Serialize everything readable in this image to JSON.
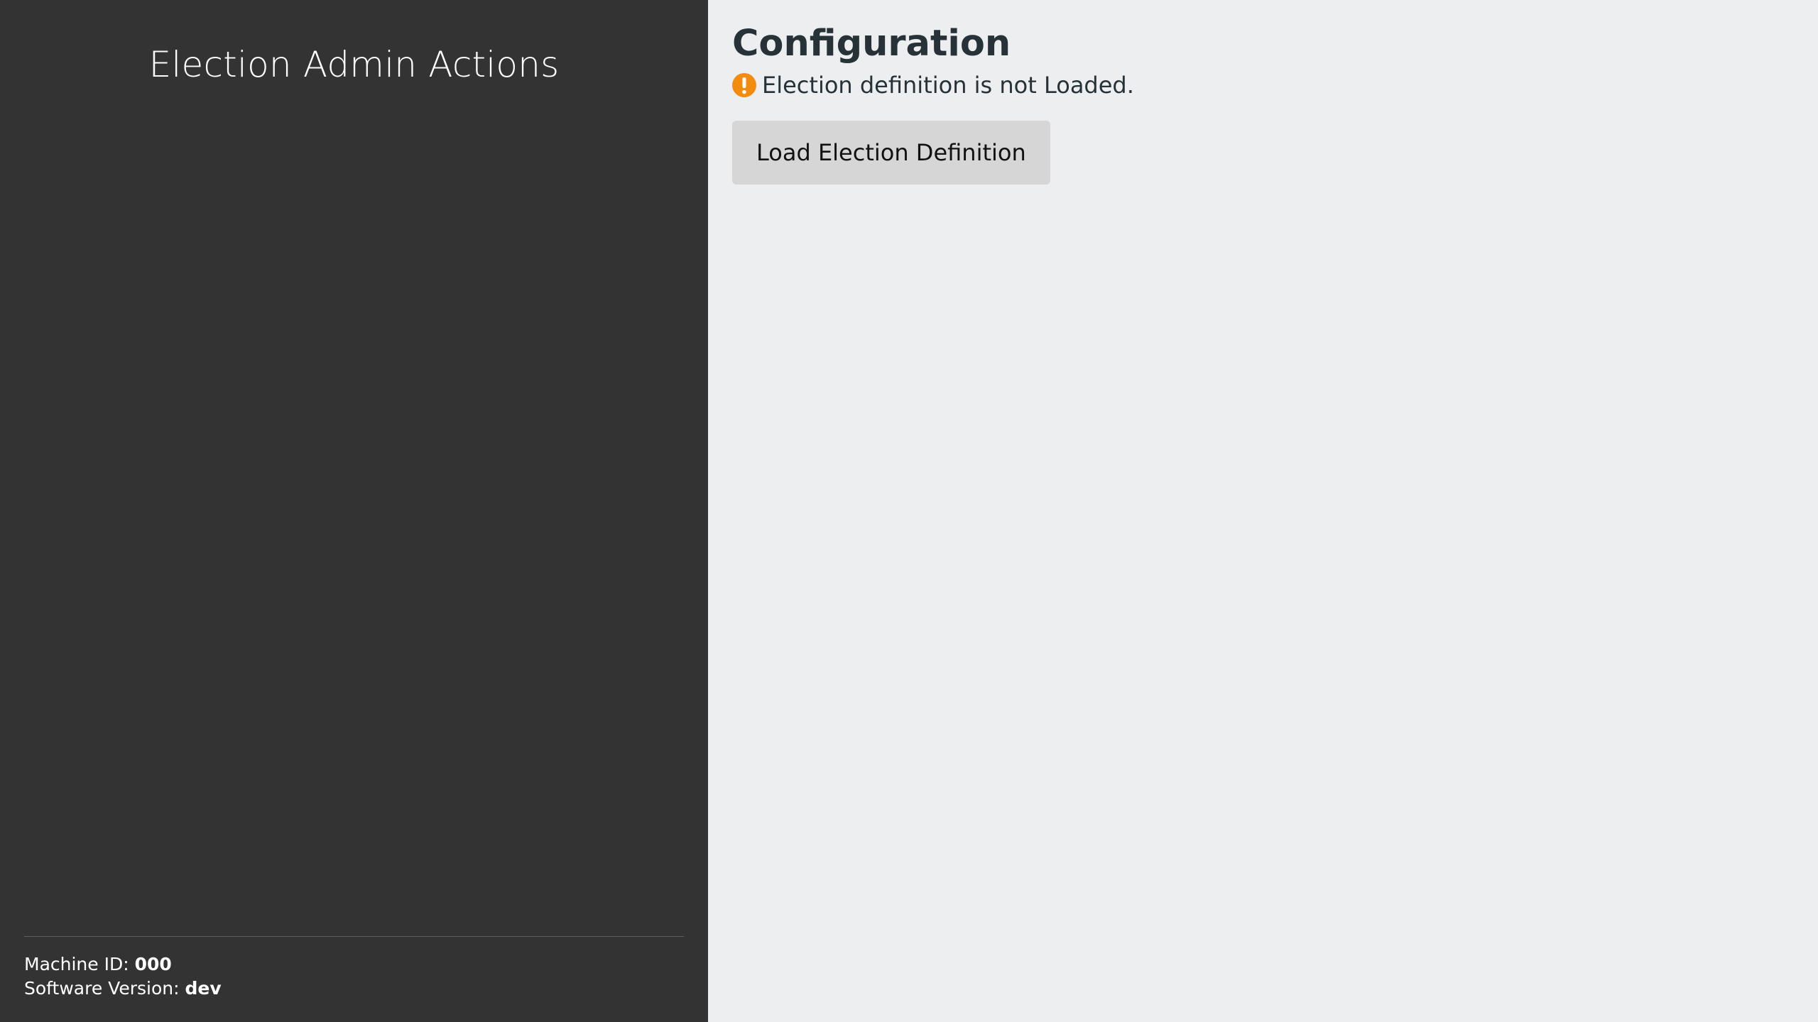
{
  "sidebar": {
    "title": "Election Admin Actions",
    "footer": {
      "machine_id_label": "Machine ID:",
      "machine_id_value": "000",
      "software_version_label": "Software Version:",
      "software_version_value": "dev"
    }
  },
  "main": {
    "title": "Configuration",
    "status": {
      "icon": "warning-circle-icon",
      "text": "Election definition is not Loaded."
    },
    "load_button_label": "Load Election Definition"
  },
  "colors": {
    "sidebar_bg": "#333333",
    "main_bg": "#edeef0",
    "warning": "#f28c0f",
    "button_bg": "#d6d6d6",
    "title_text": "#263238"
  }
}
